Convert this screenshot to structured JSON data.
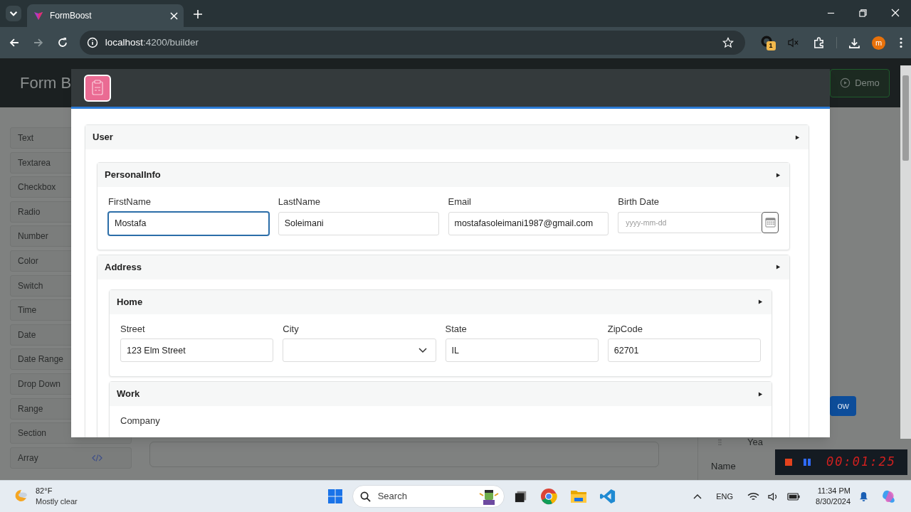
{
  "browser": {
    "tabs": [
      {
        "title": "FormBoost",
        "selected": true
      }
    ],
    "url_host": "localhost",
    "url_path": ":4200/builder",
    "extension_badge": "1",
    "profile_initial": "m"
  },
  "app": {
    "title": "Form B",
    "demo_button": "Demo",
    "palette": [
      {
        "label": "Text",
        "kind": "plain"
      },
      {
        "label": "Textarea",
        "kind": "plain"
      },
      {
        "label": "Checkbox",
        "kind": "plain"
      },
      {
        "label": "Radio",
        "kind": "plain"
      },
      {
        "label": "Number",
        "kind": "plain"
      },
      {
        "label": "Color",
        "kind": "plain"
      },
      {
        "label": "Switch",
        "kind": "plain"
      },
      {
        "label": "Time",
        "kind": "plain"
      },
      {
        "label": "Date",
        "kind": "plain"
      },
      {
        "label": "Date Range",
        "kind": "plain"
      },
      {
        "label": "Drop Down",
        "kind": "plain"
      },
      {
        "label": "Range",
        "kind": "plain"
      },
      {
        "label": "Section",
        "kind": "plain"
      },
      {
        "label": "Array",
        "kind": "code"
      }
    ],
    "preview_button": "ow",
    "column_header": "Yea",
    "column_label": "Name"
  },
  "modal": {
    "sections": [
      {
        "title": "User",
        "expanded": true,
        "children": [
          {
            "title": "PersonalInfo",
            "expanded": true,
            "fields": [
              {
                "label": "FirstName",
                "kind": "text",
                "value": "Mostafa",
                "focused": true
              },
              {
                "label": "LastName",
                "kind": "text",
                "value": "Soleimani",
                "focused": false
              },
              {
                "label": "Email",
                "kind": "text",
                "value": "mostafasoleimani1987@gmail.com",
                "focused": false
              },
              {
                "label": "Birth Date",
                "kind": "date",
                "placeholder": "yyyy-mm-dd",
                "focused": false
              }
            ]
          },
          {
            "title": "Address",
            "expanded": true,
            "children": [
              {
                "title": "Home",
                "expanded": true,
                "fields": [
                  {
                    "label": "Street",
                    "kind": "text",
                    "value": "123 Elm Street",
                    "focused": false
                  },
                  {
                    "label": "City",
                    "kind": "select",
                    "focused": false
                  },
                  {
                    "label": "State",
                    "kind": "text",
                    "value": "IL",
                    "focused": false
                  },
                  {
                    "label": "ZipCode",
                    "kind": "text",
                    "value": "62701",
                    "focused": false
                  }
                ]
              },
              {
                "title": "Work",
                "expanded": true,
                "fields": [
                  {
                    "label": "Company",
                    "kind": "label"
                  }
                ]
              }
            ]
          }
        ]
      }
    ]
  },
  "taskbar": {
    "temperature": "82°F",
    "weather": "Mostly clear",
    "search_placeholder": "Search",
    "language": "ENG",
    "time": "11:34 PM",
    "date": "8/30/2024"
  },
  "recorder": {
    "elapsed": "00:01:25"
  }
}
